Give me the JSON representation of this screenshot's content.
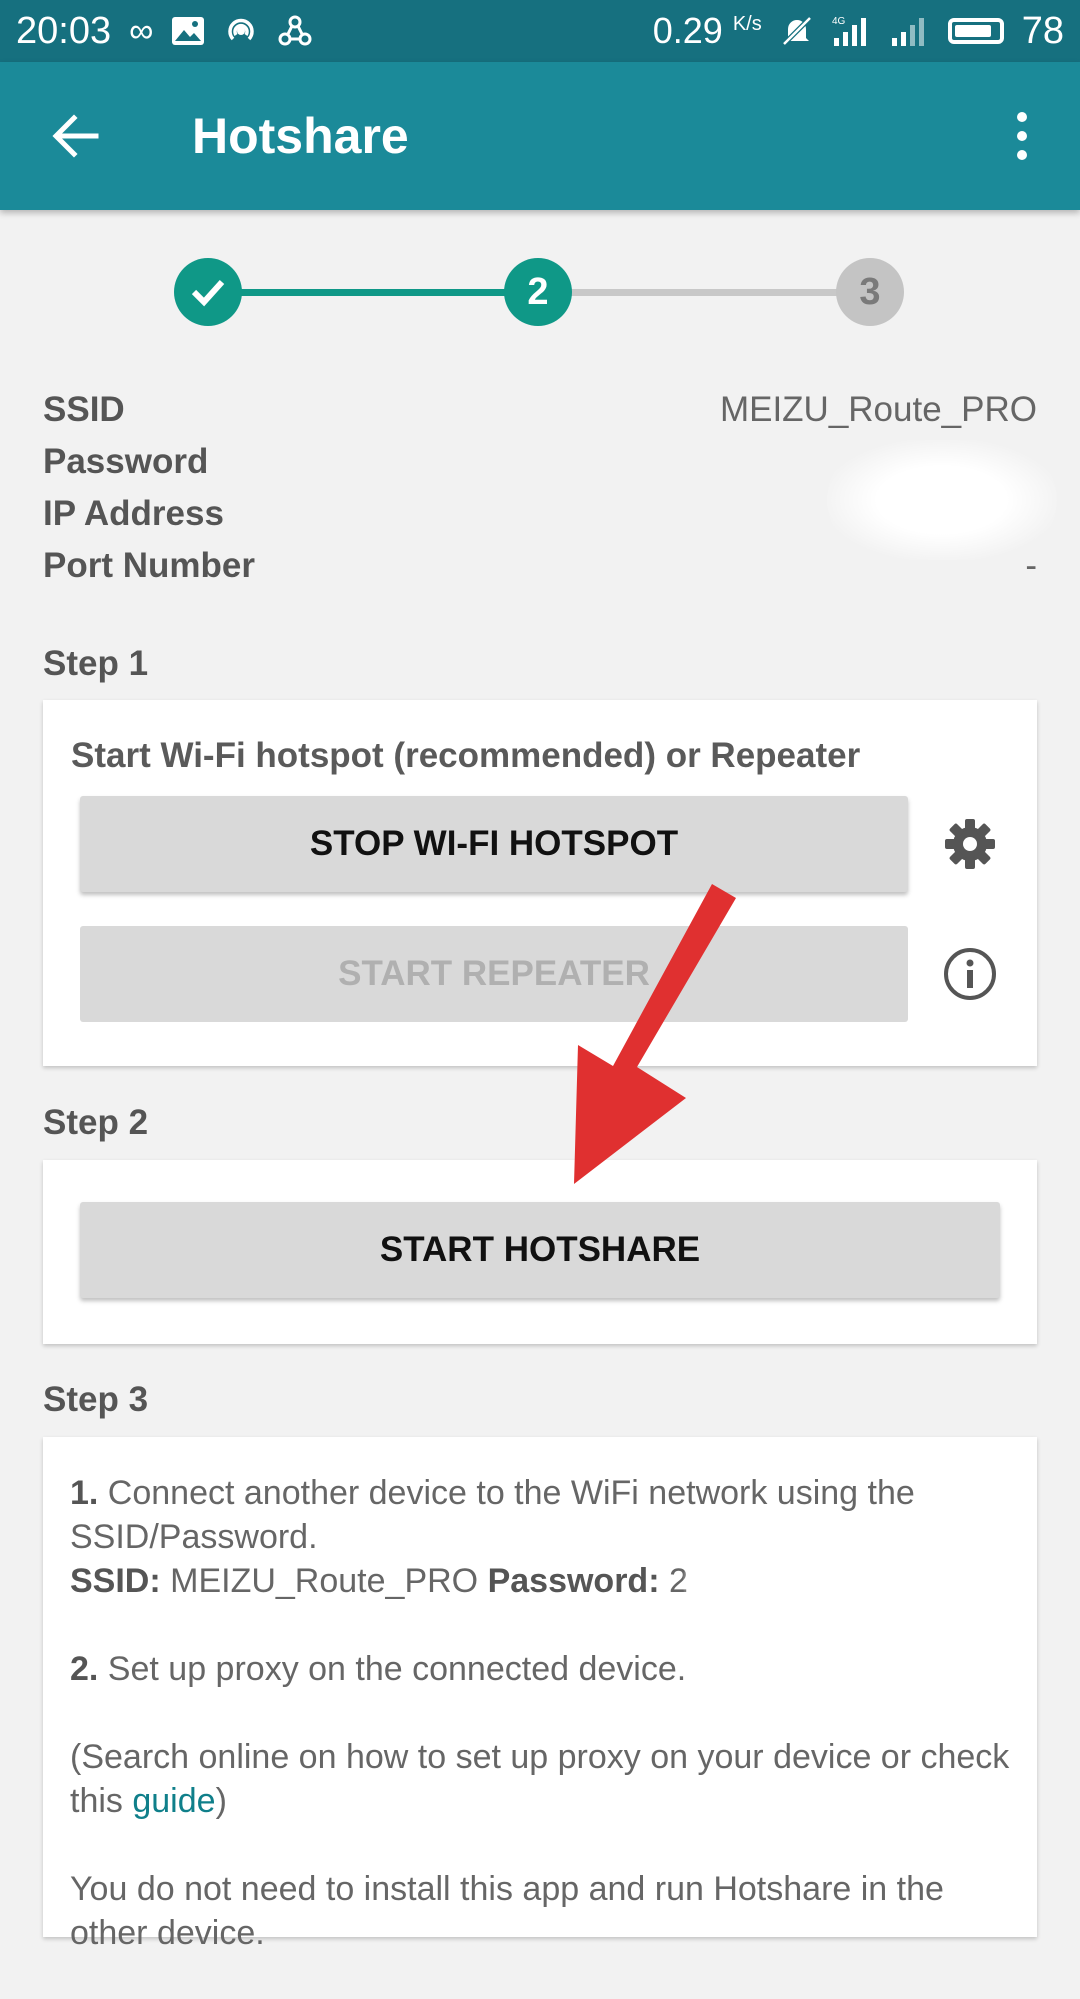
{
  "status_bar": {
    "time": "20:03",
    "speed": "0.29",
    "speed_unit": "K/s",
    "network": "4G",
    "battery": "78"
  },
  "app_bar": {
    "title": "Hotshare"
  },
  "stepper": {
    "steps": [
      "1",
      "2",
      "3"
    ],
    "current": 2
  },
  "info": {
    "ssid_label": "SSID",
    "ssid_value": "MEIZU_Route_PRO",
    "password_label": "Password",
    "password_value": "",
    "ip_label": "IP Address",
    "ip_value": "",
    "port_label": "Port Number",
    "port_value": "-"
  },
  "step1": {
    "title": "Step 1",
    "description": "Start Wi-Fi hotspot (recommended) or Repeater",
    "stop_hotspot_label": "STOP WI-FI HOTSPOT",
    "start_repeater_label": "START REPEATER"
  },
  "step2": {
    "title": "Step 2",
    "start_hotshare_label": "START HOTSHARE"
  },
  "step3": {
    "title": "Step 3",
    "item1_num": "1.",
    "item1_text": " Connect another device to the WiFi network using the SSID/Password.",
    "ssid_key": "SSID:",
    "ssid_val": " MEIZU_Route_PRO ",
    "password_key": "Password:",
    "password_val": " 2",
    "item2_num": "2.",
    "item2_text": " Set up proxy on the connected device.",
    "search_text": "(Search online on how to set up proxy on your device or check this ",
    "guide_link": "guide",
    "search_close": ")",
    "footer_text": "You do not need to install this app and run Hotshare in the other device."
  },
  "colors": {
    "status_bar": "#16707f",
    "app_bar": "#1b8a99",
    "accent": "#0f9887",
    "annotation_arrow": "#e03030"
  }
}
